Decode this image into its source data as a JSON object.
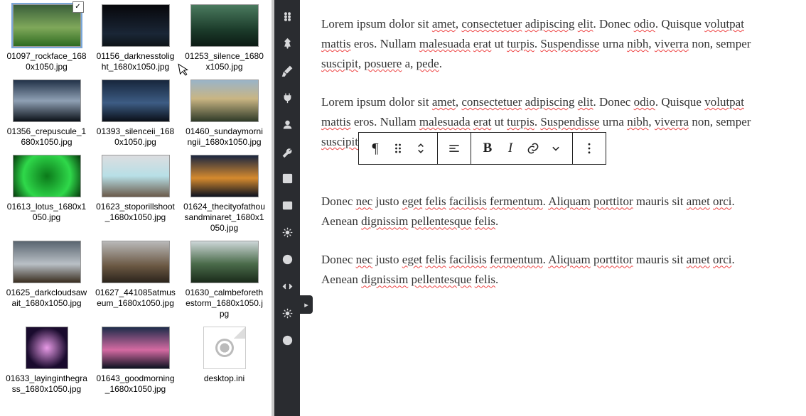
{
  "files": [
    {
      "name": "01097_rockface_1680x1050.jpg",
      "grad": "linear-gradient(#3a5f3a 0%,#7fa85a 55%,#2e6b20 100%)",
      "selected": true
    },
    {
      "name": "01156_darknesstolight_1680x1050.jpg",
      "grad": "linear-gradient(#07070b,#1a2636 70%,#0d1418)"
    },
    {
      "name": "01253_silence_1680x1050.jpg",
      "grad": "linear-gradient(#4a7a5e,#1c3c2b 60%,#0c1a14)"
    },
    {
      "name": "01356_crepuscule_1680x1050.jpg",
      "grad": "linear-gradient(#223248,#8fa0b4 50%,#0b1118)"
    },
    {
      "name": "01393_silenceii_1680x1050.jpg",
      "grad": "linear-gradient(#17263c,#3d5c84 55%,#0a0f18)"
    },
    {
      "name": "01460_sundaymorningii_1680x1050.jpg",
      "grad": "linear-gradient(#9ab4c8,#c9b583 45%,#2f3a28)"
    },
    {
      "name": "01613_lotus_1680x1050.jpg",
      "grad": "radial-gradient(circle,#0b7a1a 0%,#2fd84a 60%,#063a0c 100%)"
    },
    {
      "name": "01623_stoporillshoot_1680x1050.jpg",
      "grad": "linear-gradient(#dcdde0 0%,#b7dfe6 50%,#6a5a4a 100%)"
    },
    {
      "name": "01624_thecityofathousandminaret_1680x1050.jpg",
      "grad": "linear-gradient(#1a2640,#d58a2e 55%,#0c1220)"
    },
    {
      "name": "01625_darkcloudsawait_1680x1050.jpg",
      "grad": "linear-gradient(#5a6570,#b9c0c6 55%,#3a2e20)"
    },
    {
      "name": "01627_441085atmuseum_1680x1050.jpg",
      "grad": "linear-gradient(#b9b9b9,#6a5742 60%,#2b241c)"
    },
    {
      "name": "01630_calmbeforethestorm_1680x1050.jpg",
      "grad": "linear-gradient(#cdd6d8 0%,#4a6b4a 55%,#1a2a1a 100%)"
    },
    {
      "name": "01633_layinginthegrass_1680x1050.jpg",
      "grad": "radial-gradient(circle,#e79ae6 0%,#1a0b2e 70%)",
      "square": true
    },
    {
      "name": "01643_goodmorning_1680x1050.jpg",
      "grad": "linear-gradient(#1d2c4a,#d46aa2 55%,#0b1220)"
    },
    {
      "name": "desktop.ini",
      "ini": true
    }
  ],
  "sidebar_icons": [
    "grip",
    "pin",
    "brush",
    "plug",
    "user",
    "wrench",
    "layout",
    "panel",
    "gear",
    "yoast",
    "code",
    "gear2",
    "play"
  ],
  "paragraphs": [
    "Lorem ipsum dolor sit amet, consectetuer adipiscing elit. Donec odio. Quisque volutpat mattis eros. Nullam malesuada erat ut turpis. Suspendisse urna nibh, viverra non, semper suscipit, posuere a, pede.",
    "Lorem ipsum dolor sit amet, consectetuer adipiscing elit. Donec odio. Quisque volutpat mattis eros. Nullam malesuada erat ut turpis. Suspendisse urna nibh, viverra non, semper suscipit, posuere a, pede.",
    "Donec nec justo eget felis facilisis fermentum. Aliquam porttitor mauris sit amet orci. Aenean dignissim pellentesque felis.",
    "Donec nec justo eget felis facilisis fermentum. Aliquam porttitor mauris sit amet orci. Aenean dignissim pellentesque felis."
  ],
  "squiggle_words": [
    "amet",
    "consectetuer",
    "adipiscing",
    "elit",
    "odio",
    "volutpat",
    "mattis",
    "malesuada",
    "erat",
    "turpis",
    "Suspendisse",
    "nibh",
    "viverra",
    "suscipit",
    "posuere",
    "pede",
    "nec",
    "eget",
    "felis",
    "facilisis",
    "fermentum",
    "Aliquam",
    "porttitor",
    "amet",
    "orci",
    "dignissim",
    "pellentesque",
    "felis"
  ],
  "toolbar": {
    "block_type": "paragraph",
    "drag": "drag",
    "move": "move",
    "align": "align-left",
    "bold": "B",
    "italic": "I",
    "link": "link",
    "more_rich": "more",
    "options": "options"
  }
}
